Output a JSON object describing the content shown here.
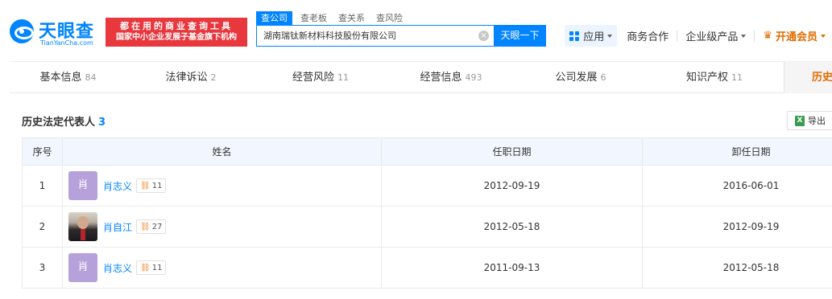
{
  "header": {
    "logo_name": "天眼查",
    "logo_url": "TianYanCha.com",
    "promo_line1": "都在用的商业查询工具",
    "promo_line2": "国家中小企业发展子基金旗下机构",
    "search_tabs": [
      "查公司",
      "查老板",
      "查关系",
      "查风险"
    ],
    "search_value": "湖南瑞钛新材料科技股份有限公司",
    "search_button": "天眼一下",
    "clear_glyph": "×",
    "nav": {
      "apps_label": "应用",
      "business": "商务合作",
      "enterprise": "企业级产品",
      "vip": "开通会员"
    }
  },
  "section_tabs": [
    {
      "label": "基本信息",
      "count": "84"
    },
    {
      "label": "法律诉讼",
      "count": "2"
    },
    {
      "label": "经营风险",
      "count": "11"
    },
    {
      "label": "经营信息",
      "count": "493"
    },
    {
      "label": "公司发展",
      "count": "6"
    },
    {
      "label": "知识产权",
      "count": "11"
    },
    {
      "label": "历史",
      "count": ""
    }
  ],
  "section": {
    "title": "历史法定代表人",
    "count": "3",
    "export_label": "导出",
    "export_icon_text": "X"
  },
  "table": {
    "headers": [
      "序号",
      "姓名",
      "任职日期",
      "卸任日期"
    ],
    "rows": [
      {
        "no": "1",
        "avatar_text": "肖",
        "name": "肖志义",
        "badge": "11",
        "start": "2012-09-19",
        "end": "2016-06-01"
      },
      {
        "no": "2",
        "avatar_text": "",
        "name": "肖自江",
        "badge": "27",
        "start": "2012-05-18",
        "end": "2012-09-19"
      },
      {
        "no": "3",
        "avatar_text": "肖",
        "name": "肖志义",
        "badge": "11",
        "start": "2011-09-13",
        "end": "2012-05-18"
      }
    ]
  },
  "colors": {
    "brand_blue": "#0084ff",
    "promo_red": "#e8373d",
    "vip_orange": "#e06c00",
    "avatar_purple": "#b6a1db"
  }
}
